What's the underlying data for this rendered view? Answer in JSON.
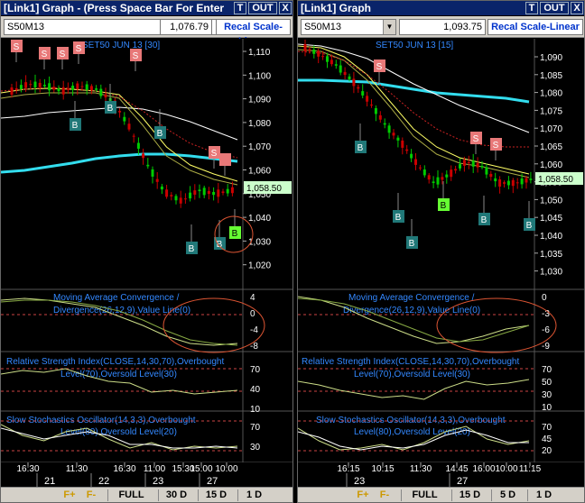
{
  "left": {
    "title": "[Link1] Graph  - (Press Space Bar For Enter",
    "btn_t": "T",
    "btn_out": "OUT",
    "btn_x": "X",
    "symbol": "S50M13",
    "last_value": "1,076.79",
    "recal_label": "Recal Scale-Linear",
    "chart_label": "SET50 JUN 13  [30]",
    "price_marker": "1,058.50",
    "price_ticks": [
      "1,110",
      "1,100",
      "1,090",
      "1,080",
      "1,070",
      "1,060",
      "1,050",
      "1,040",
      "1,030",
      "1,020"
    ],
    "macd_label_1": "Moving Average Convergence /",
    "macd_label_2": "Divergence(26,12,9),Value Line(0)",
    "macd_ticks": [
      "4",
      "0",
      "-4",
      "-8"
    ],
    "rsi_label_1": "Relative Strength Index(CLOSE,14,30,70),Overbought",
    "rsi_label_2": "Level(70),Oversold Level(30)",
    "rsi_ticks": [
      "70",
      "40",
      "10"
    ],
    "sto_label_1": "Slow Stochastics Oscillator(14,3,3),Overbought",
    "sto_label_2": "Level(80),Oversold Level(20)",
    "sto_ticks": [
      "70",
      "30"
    ],
    "time_labels": [
      "16:30",
      "11:30",
      "16:30",
      "11:00",
      "15:30",
      "15:00",
      "10:00"
    ],
    "date_labels": [
      "21",
      "22",
      "23",
      "27"
    ],
    "signals_s": [
      "S",
      "S",
      "S",
      "S",
      "S",
      "S"
    ],
    "signals_b": [
      "B",
      "B",
      "B",
      "B",
      "B",
      "B"
    ],
    "bottom": {
      "f_plus": "F+",
      "f_minus": "F-",
      "full": "FULL",
      "r1": "30 D",
      "r2": "15 D",
      "r3": "1 D"
    }
  },
  "right": {
    "title": "[Link1] Graph",
    "btn_t": "T",
    "btn_out": "OUT",
    "btn_x": "X",
    "symbol": "S50M13",
    "last_value": "1,093.75",
    "recal_label": "Recal Scale-Linear",
    "chart_label": "SET50 JUN 13   [15]",
    "price_marker": "1,058.50",
    "price_ticks": [
      "1,090",
      "1,085",
      "1,080",
      "1,075",
      "1,070",
      "1,065",
      "1,060",
      "1,055",
      "1,050",
      "1,045",
      "1,040",
      "1,035",
      "1,030"
    ],
    "macd_label_1": "Moving Average Convergence /",
    "macd_label_2": "Divergence(26,12,9),Value Line(0)",
    "macd_ticks": [
      "0",
      "-3",
      "-6",
      "-9"
    ],
    "rsi_label_1": "Relative Strength Index(CLOSE,14,30,70),Overbought",
    "rsi_label_2": "Level(70),Oversold Level(30)",
    "rsi_ticks": [
      "70",
      "50",
      "30",
      "10"
    ],
    "sto_label_1": "Slow Stochastics Oscillator(14,3,3),Overbought",
    "sto_label_2": "Level(80),Oversold Level(20)",
    "sto_ticks": [
      "70",
      "45",
      "20"
    ],
    "time_labels": [
      "16:15",
      "10:15",
      "11:30",
      "14:45",
      "16:00",
      "10:00",
      "11:15"
    ],
    "date_labels": [
      "23",
      "27"
    ],
    "signals_s": [
      "S",
      "S",
      "S"
    ],
    "signals_b": [
      "B",
      "B",
      "B",
      "B",
      "B",
      "B"
    ],
    "bottom": {
      "f_plus": "F+",
      "f_minus": "F-",
      "full": "FULL",
      "r1": "15 D",
      "r2": "5 D",
      "r3": "1 D"
    }
  },
  "colors": {
    "bg": "#000000",
    "grid": "#222222",
    "up_candle": "#00cc00",
    "down_candle": "#cc0000",
    "sell_box": "#e87878",
    "buy_box": "#207878",
    "buy_box_active": "#66ff33",
    "ma_cyan": "#33ddee",
    "ma_white": "#ffffff",
    "ma_yellow": "#ffff66",
    "ma_red_dotted": "#cc2222",
    "indicator_line": "#ccdd88",
    "ref_dashed": "#cc4444",
    "ellipse": "#dd5533",
    "label_blue": "#3388ff",
    "axis_text": "#ffffff",
    "price_marker_bg": "#ccffcc"
  }
}
